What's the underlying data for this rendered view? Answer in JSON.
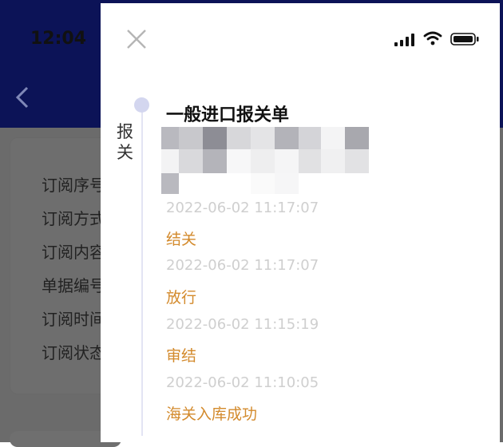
{
  "background": {
    "status_time": "12:04",
    "rows": [
      {
        "label": "订阅序号"
      },
      {
        "label": "订阅方式"
      },
      {
        "label": "订阅内容"
      },
      {
        "label": "单据编号"
      },
      {
        "label": "订阅时间"
      },
      {
        "label": "订阅状态"
      }
    ]
  },
  "drawer": {
    "group_label": "报关",
    "doc_title": "一般进口报关单",
    "events": [
      {
        "time": "2022-06-02 11:17:07",
        "status": "结关"
      },
      {
        "time": "2022-06-02 11:17:07",
        "status": "放行"
      },
      {
        "time": "2022-06-02 11:15:19",
        "status": "审结"
      },
      {
        "time": "2022-06-02 11:10:05",
        "status": "海关入库成功"
      }
    ]
  },
  "colors": {
    "header_navy": "#0c1357",
    "status_orange": "#d38a2c",
    "timeline_dot": "#d3d6ef",
    "time_grey": "#cfcfcf"
  },
  "icons": [
    "close-icon",
    "cellular-signal-icon",
    "wifi-icon",
    "battery-icon",
    "back-arrow-icon"
  ]
}
